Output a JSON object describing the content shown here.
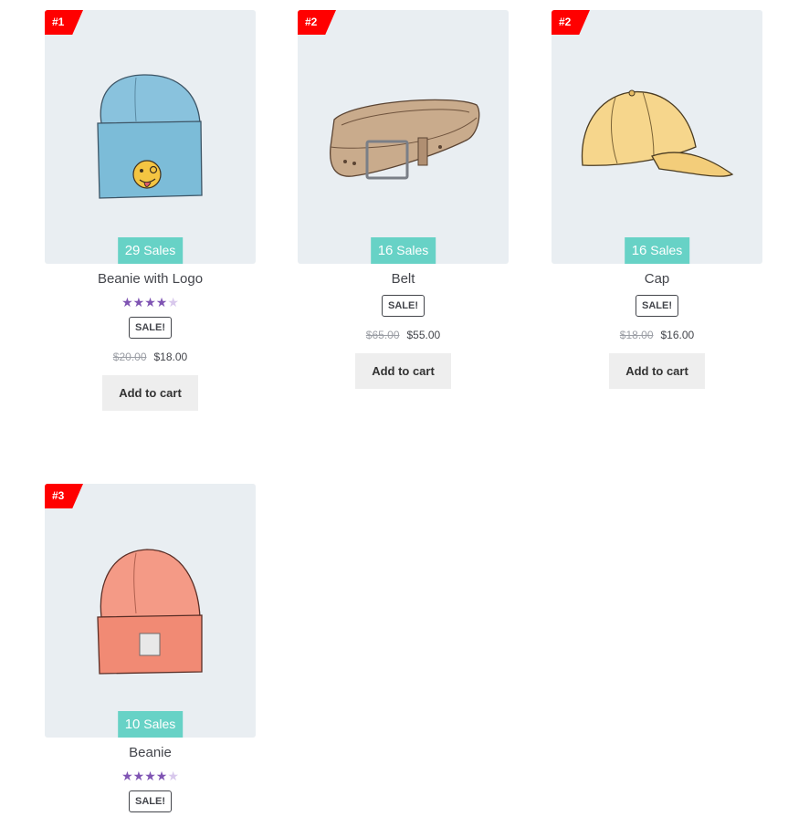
{
  "products": [
    {
      "rank": "#1",
      "sales_count": "29",
      "sales_label": "Sales",
      "title": "Beanie with Logo",
      "rating": 4,
      "rating_max": 5,
      "sale_label": "SALE!",
      "old_price": "$20.00",
      "new_price": "$18.00",
      "cart_label": "Add to cart",
      "icon": "blue-beanie-with-logo"
    },
    {
      "rank": "#2",
      "sales_count": "16",
      "sales_label": "Sales",
      "title": "Belt",
      "sale_label": "SALE!",
      "old_price": "$65.00",
      "new_price": "$55.00",
      "cart_label": "Add to cart",
      "icon": "leather-belt"
    },
    {
      "rank": "#2",
      "sales_count": "16",
      "sales_label": "Sales",
      "title": "Cap",
      "sale_label": "SALE!",
      "old_price": "$18.00",
      "new_price": "$16.00",
      "cart_label": "Add to cart",
      "icon": "yellow-cap"
    },
    {
      "rank": "#3",
      "sales_count": "10",
      "sales_label": "Sales",
      "title": "Beanie",
      "rating": 4,
      "rating_max": 5,
      "sale_label": "SALE!",
      "icon": "orange-beanie"
    }
  ],
  "colors": {
    "rank_badge": "#ff0000",
    "sales_badge": "#67d2c6",
    "thumb_bg": "#e9eef2",
    "star": "#7f54b3"
  }
}
